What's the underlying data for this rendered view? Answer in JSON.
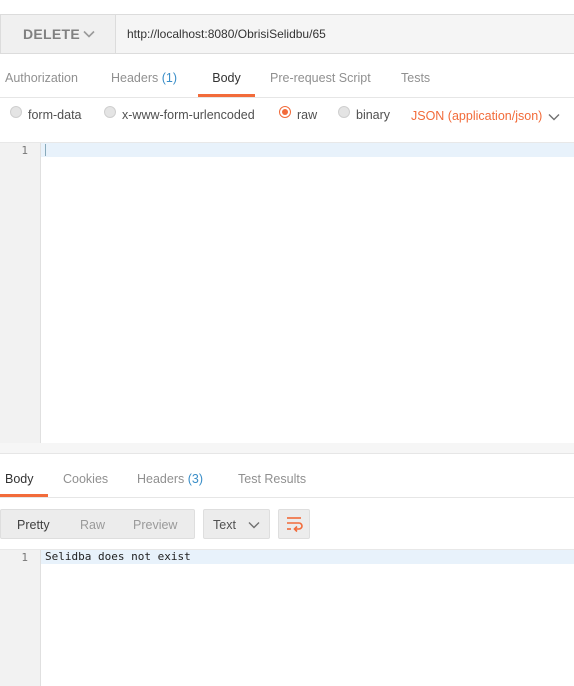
{
  "request": {
    "method": "DELETE",
    "url": "http://localhost:8080/ObrisiSelidbu/65"
  },
  "request_tabs": [
    {
      "label": "Authorization",
      "badge": ""
    },
    {
      "label": "Headers",
      "badge": "(1)"
    },
    {
      "label": "Body",
      "badge": ""
    },
    {
      "label": "Pre-request Script",
      "badge": ""
    },
    {
      "label": "Tests",
      "badge": ""
    }
  ],
  "body_types": [
    {
      "label": "form-data",
      "selected": false
    },
    {
      "label": "x-www-form-urlencoded",
      "selected": false
    },
    {
      "label": "raw",
      "selected": true
    },
    {
      "label": "binary",
      "selected": false
    }
  ],
  "content_type": "JSON (application/json)",
  "request_editor": {
    "line_numbers": [
      "1"
    ]
  },
  "response_tabs": [
    {
      "label": "Body",
      "badge": ""
    },
    {
      "label": "Cookies",
      "badge": ""
    },
    {
      "label": "Headers",
      "badge": "(3)"
    },
    {
      "label": "Test Results",
      "badge": ""
    }
  ],
  "response_view": {
    "modes": [
      "Pretty",
      "Raw",
      "Preview"
    ],
    "format": "Text"
  },
  "response_body": {
    "line_numbers": [
      "1"
    ],
    "text": "Selidba does not exist"
  },
  "colors": {
    "accent": "#f26b3a",
    "badge": "#3a8ec8"
  },
  "icons": {
    "method_dropdown": "chevron-down-icon",
    "content_type_dropdown": "chevron-down-icon",
    "format_dropdown": "chevron-down-icon",
    "wrap": "wrap-lines-icon"
  }
}
